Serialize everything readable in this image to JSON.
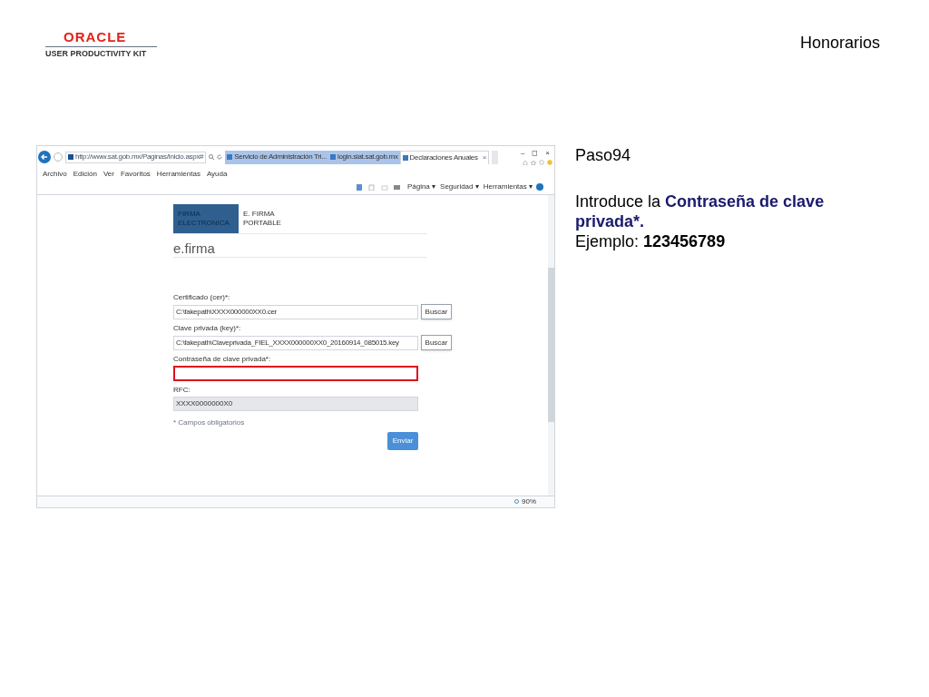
{
  "header": {
    "logo_brand": "ORACLE",
    "logo_product": "USER PRODUCTIVITY KIT",
    "title": "Honorarios"
  },
  "browser": {
    "address": "http://www.sat.gob.mx/Paginas/Inicio.aspx#",
    "tabs": [
      {
        "label": "Servicio de Administración Tri...",
        "selected": false
      },
      {
        "label": "login.siat.sat.gob.mx",
        "selected": false
      },
      {
        "label": "Declaraciones Anuales",
        "selected": true,
        "close": "×"
      }
    ],
    "window_controls": [
      "–",
      "◻",
      "×"
    ],
    "menu": [
      "Archivo",
      "Edición",
      "Ver",
      "Favoritos",
      "Herramientas",
      "Ayuda"
    ],
    "toolbar": [
      "Página ▾",
      "Seguridad ▾",
      "Herramientas ▾"
    ],
    "zoom": "90%",
    "page": {
      "nav_tabs": [
        {
          "label": "FIRMA ELECTRONICA",
          "selected": true
        },
        {
          "label": "E. FIRMA PORTABLE",
          "selected": false
        }
      ],
      "heading": "e.firma",
      "fields": [
        {
          "kind": "file",
          "label": "Certificado (cer)*:",
          "value": "C:\\fakepath\\XXXX000000XX0.cer",
          "button": "Buscar",
          "highlighted": false
        },
        {
          "kind": "file",
          "label": "Clave privada (key)*:",
          "value": "C:\\fakepath\\Claveprivada_FIEL_XXXX000000XX0_20160914_085015.key",
          "button": "Buscar",
          "highlighted": false
        },
        {
          "kind": "password",
          "label": "Contraseña de clave privada*:",
          "highlighted": true
        },
        {
          "kind": "readonly",
          "label": "RFC:",
          "value": "XXXX0000000X0",
          "highlighted": false
        }
      ],
      "note": "* Campos obligatorios",
      "submit": "Enviar"
    }
  },
  "instruction": {
    "step": "Paso94",
    "text": "Introduce la **Contraseña de clave privada*.**",
    "example": "Ejemplo: **123456789**"
  }
}
